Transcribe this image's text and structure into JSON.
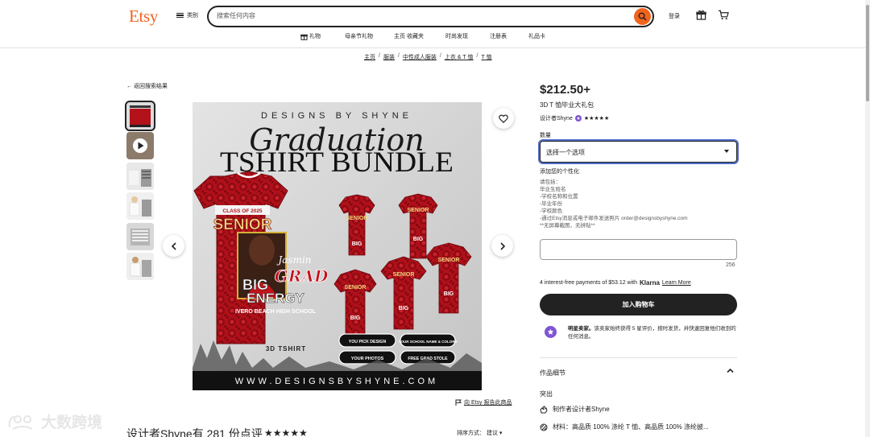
{
  "header": {
    "logo": "Etsy",
    "categories_label": "类别",
    "search_placeholder": "搜索任何内容",
    "login_label": "登录",
    "subnav": [
      {
        "label": "礼物",
        "icon": "gift-icon"
      },
      {
        "label": "母亲节礼物"
      },
      {
        "label": "主页 收藏夹"
      },
      {
        "label": "时尚发现"
      },
      {
        "label": "注册表"
      },
      {
        "label": "礼品卡"
      }
    ]
  },
  "breadcrumb": [
    "主页",
    "服装",
    "中性成人服装",
    "上衣 & T 恤",
    "T 恤"
  ],
  "back_link": "返回搜索结果",
  "gallery": {
    "image_text": {
      "top": "DESIGNS BY SHYNE",
      "script": "Graduation",
      "headline": "TSHIRT BUNDLE",
      "class_of": "CLASS OF 2025",
      "senior": "SENIOR",
      "name": "Jasmin",
      "big": "BIG",
      "crap": "GRAD",
      "energy": "ENERGY",
      "school": "IVERO BEACH HIGH SCHOOL",
      "label_3d": "3D TSHIRT",
      "pill1": "YOU PICK DESIGN",
      "pill2": "YOUR SCHOOL NAME & COLORS",
      "pill3": "YOUR PHOTOS",
      "pill4": "FREE GRAD STOLE",
      "url": "WWW.DESIGNSBYSHYNE.COM"
    },
    "report_label": "向 Etsy 报告此商品"
  },
  "product": {
    "price": "$212.50+",
    "title": "3D T 恤毕业大礼包",
    "seller": "设计者Shyne",
    "seller_stars": "★★★★★",
    "quantity_label": "数量",
    "select_value": "选择一个选项",
    "personalization_label": "添加您的个性化",
    "instructions": [
      "请包括：",
      "毕业生姓名",
      "-学校名称和位置",
      "-毕业年份",
      "-学校颜色",
      "-通过Etsy消息或电子邮件发送照片 order@designsbyshyne.com",
      "**无屏幕截图，无拼贴**"
    ],
    "char_count": "256",
    "klarna_text": "4 interest-free payments of $53.12 with",
    "klarna_brand": "Klarna",
    "klarna_link": "Learn More",
    "cart_button": "加入购物车",
    "star_seller_bold": "明星卖家。",
    "star_seller_text": "该卖家始终获得 5 星评价，按时发货，并快速回复他们收到的任何消息。",
    "details_title": "作品细节",
    "highlights_label": "突出",
    "detail_rows": [
      {
        "icon": "hand-icon",
        "text": "制作者设计者Shyne"
      },
      {
        "icon": "material-icon",
        "text": "材料：高品质 100% 涤纶 T 恤、高品质 100% 涤纶披..."
      }
    ]
  },
  "reviews": {
    "heading": "设计者Shyne有 281 份点评",
    "stars": "★★★★★",
    "sort_label": "排序方式：",
    "sort_value": "建议"
  },
  "watermark": "大数跨境",
  "colors": {
    "brand": "#f1641e",
    "text": "#222222",
    "focus": "#4d6bc6",
    "star_seller": "#7f55d4"
  }
}
